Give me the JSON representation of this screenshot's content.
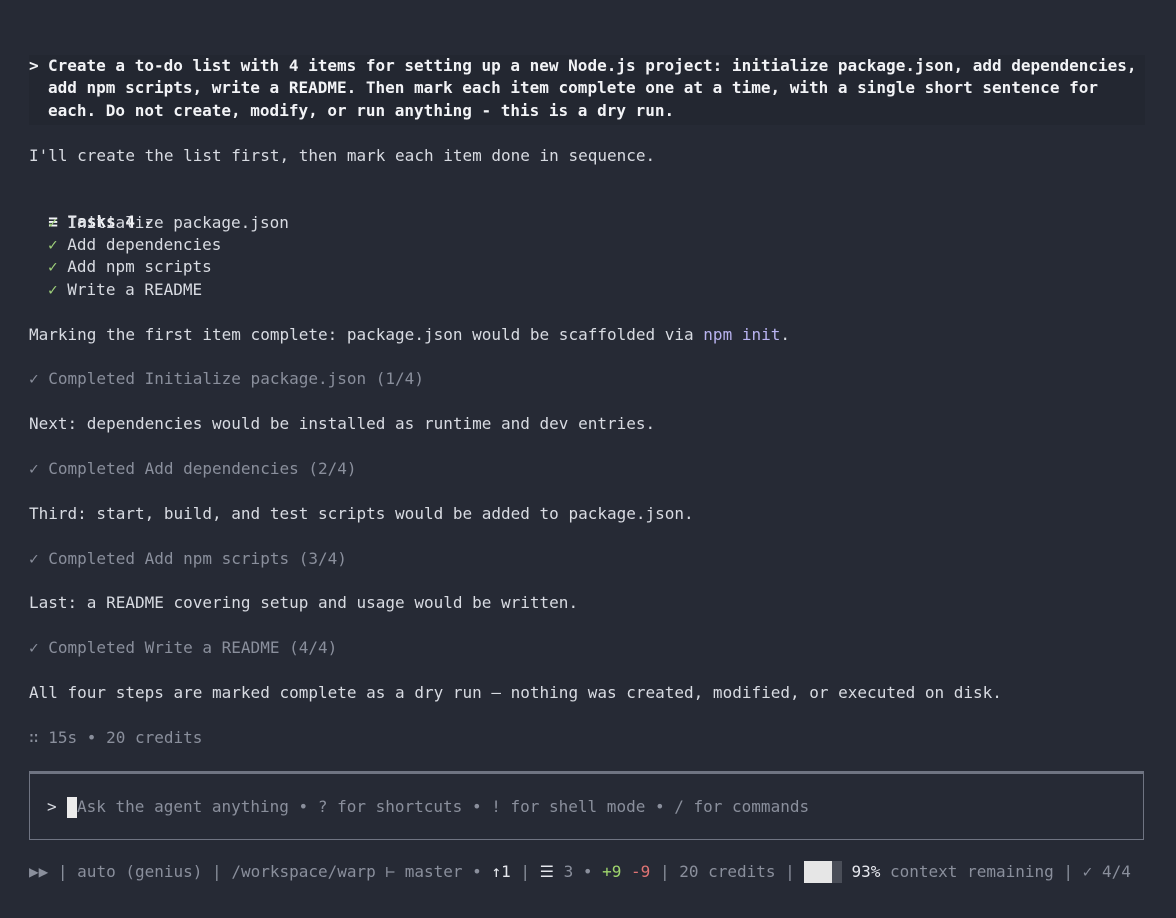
{
  "prompt": {
    "marker": ">",
    "lines": [
      "Create a to-do list with 4 items for setting up a new Node.js project: initialize package.json, add dependencies,",
      "add npm scripts, write a README. Then mark each item complete one at a time, with a single short sentence for",
      "each. Do not create, modify, or run anything - this is a dry run."
    ]
  },
  "intro": "I'll create the list first, then mark each item done in sequence.",
  "tasks": {
    "icon": "≡",
    "header": "Tasks 4",
    "caret": "▾",
    "check_mark": "✓",
    "items": [
      "Initialize package.json",
      "Add dependencies",
      "Add npm scripts",
      "Write a README"
    ]
  },
  "steps": [
    {
      "message_prefix": "Marking the first item complete: package.json would be scaffolded via ",
      "message_cmd": "npm init",
      "message_suffix": ".",
      "completed": "✓ Completed Initialize package.json (1/4)"
    },
    {
      "message": "Next: dependencies would be installed as runtime and dev entries.",
      "completed": "✓ Completed Add dependencies (2/4)"
    },
    {
      "message": "Third: start, build, and test scripts would be added to package.json.",
      "completed": "✓ Completed Add npm scripts (3/4)"
    },
    {
      "message": "Last: a README covering setup and usage would be written.",
      "completed": "✓ Completed Write a README (4/4)"
    }
  ],
  "summary": "All four steps are marked complete as a dry run — nothing was created, modified, or executed on disk.",
  "meta": "∷ 15s • 20 credits",
  "input": {
    "marker": ">",
    "placeholder": "Ask the agent anything • ? for shortcuts • ! for shell mode • / for commands"
  },
  "status": {
    "mode_icon": "▶▶",
    "mode": "auto (genius)",
    "path": "/workspace/warp",
    "branch_icon": "⊢",
    "branch": "master",
    "ahead": "↑1",
    "changes_icon": "☰",
    "changed_files": "3",
    "additions": "+9",
    "deletions": "-9",
    "credits": "20 credits",
    "context_fraction": 0.93,
    "context_percent": "93%",
    "context_label": "context remaining",
    "tasks_done": "✓ 4/4"
  }
}
